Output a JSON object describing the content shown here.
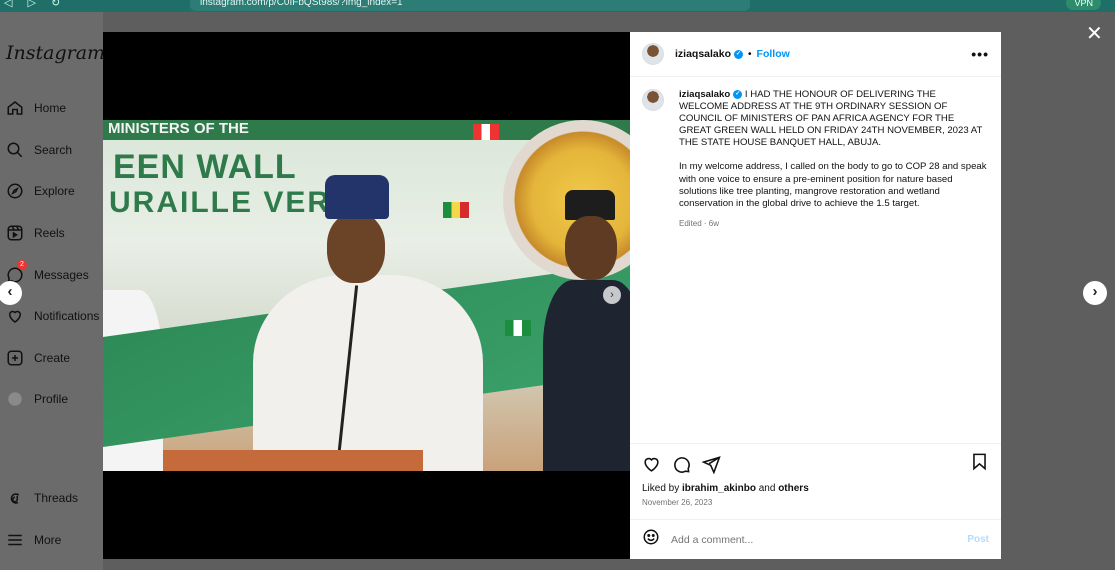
{
  "browser": {
    "url": "instagram.com/p/C0IFbQSt98s/?img_index=1",
    "nav_glyphs": "◁ ▷ ↻",
    "vpn_label": "VPN"
  },
  "sidebar": {
    "logo": "Instagram",
    "items": [
      {
        "label": "Home",
        "icon": "home-icon"
      },
      {
        "label": "Search",
        "icon": "search-icon"
      },
      {
        "label": "Explore",
        "icon": "compass-icon"
      },
      {
        "label": "Reels",
        "icon": "reels-icon"
      },
      {
        "label": "Messages",
        "icon": "messenger-icon",
        "badge": "2"
      },
      {
        "label": "Notifications",
        "icon": "heart-icon"
      },
      {
        "label": "Create",
        "icon": "plus-square-icon"
      },
      {
        "label": "Profile",
        "icon": "avatar-icon"
      },
      {
        "label": "Threads",
        "icon": "threads-icon"
      },
      {
        "label": "More",
        "icon": "menu-icon"
      }
    ]
  },
  "media": {
    "banner_top": "MINISTERS OF THE",
    "banner_line1": "EEN WALL",
    "banner_line2": "URAILLE VERTE"
  },
  "post": {
    "username": "iziaqsalako",
    "follow_label": "Follow",
    "more_label": "•••",
    "caption_p1": "I HAD THE HONOUR OF DELIVERING THE WELCOME ADDRESS AT THE 9TH ORDINARY SESSION OF COUNCIL OF MINISTERS OF PAN AFRICA AGENCY FOR THE GREAT GREEN WALL HELD ON FRIDAY 24TH NOVEMBER, 2023 AT THE STATE HOUSE BANQUET HALL, ABUJA.",
    "caption_p2": "In my welcome address, I called on the body to go to COP 28 and speak with one voice to ensure a pre-eminent position for nature based solutions like tree planting, mangrove restoration and wetland conservation in the global drive to achieve the 1.5 target.",
    "edited": "Edited · 6w",
    "liked_prefix": "Liked by ",
    "liked_user": "ibrahim_akinbo",
    "liked_and": " and ",
    "liked_others": "others",
    "date": "November 26, 2023",
    "comment_placeholder": "Add a comment...",
    "post_label": "Post"
  },
  "overlay": {
    "close": "✕",
    "prev": "‹",
    "next": "›",
    "carousel_next": "›"
  },
  "colors": {
    "accent": "#0095f6",
    "post_disabled": "#b3dbff",
    "browser_bar": "#1f6e67"
  }
}
